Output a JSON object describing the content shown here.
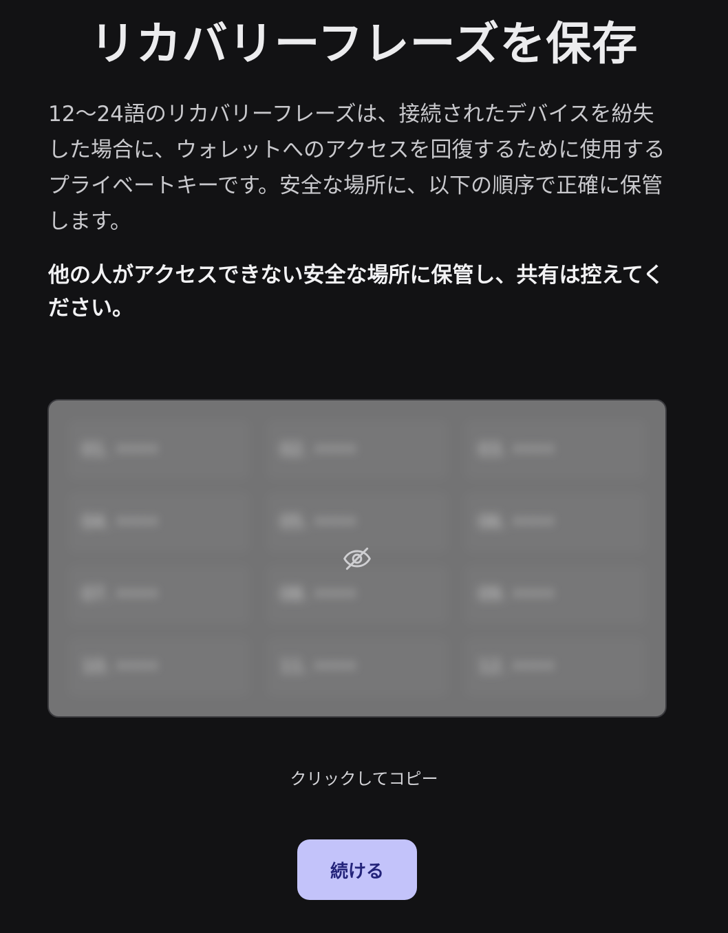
{
  "page": {
    "title": "リカバリーフレーズを保存",
    "description": "12〜24語のリカバリーフレーズは、接続されたデバイスを紛失した場合に、ウォレットへのアクセスを回復するために使用するプライベートキーです。安全な場所に、以下の順序で正確に保管します。",
    "warning": "他の人がアクセスできない安全な場所に保管し、共有は控えてください。"
  },
  "phrase_box": {
    "state": "hidden",
    "words": [
      "01. ••••",
      "02. ••••",
      "03. ••••",
      "04. ••••",
      "05. ••••",
      "06. ••••",
      "07. ••••",
      "08. ••••",
      "09. ••••",
      "10. ••••",
      "11. ••••",
      "12. ••••"
    ],
    "icon": "eye-off-icon"
  },
  "copy_label": "クリックしてコピー",
  "continue_button": {
    "label": "続ける"
  },
  "colors": {
    "background": "#121214",
    "phrase_box": "#737374",
    "button_bg": "#c3c3fa",
    "button_text": "#23237a"
  }
}
